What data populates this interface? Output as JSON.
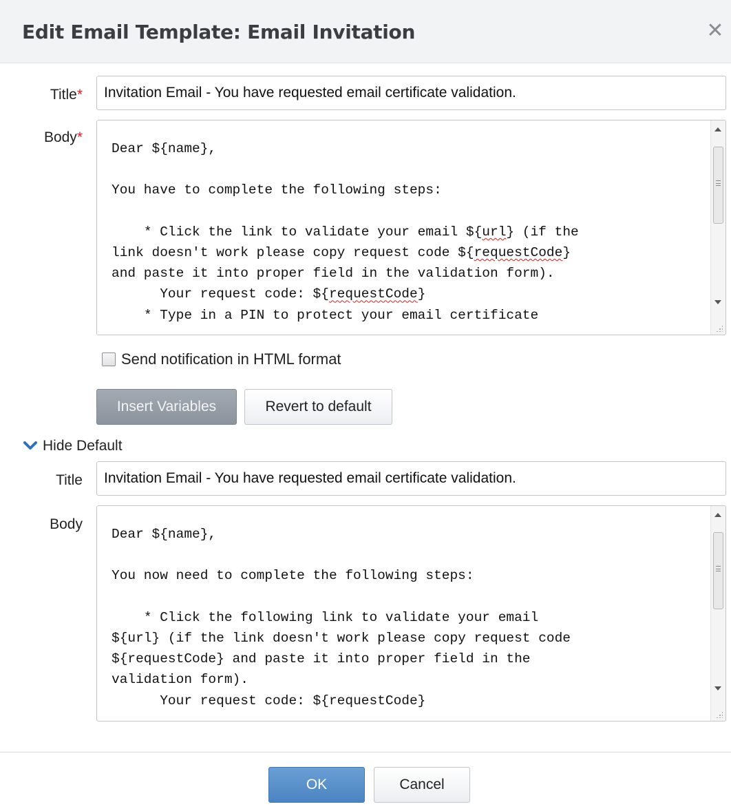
{
  "dialog": {
    "title": "Edit Email Template: Email Invitation",
    "close_glyph": "✕"
  },
  "form": {
    "title_label": "Title",
    "body_label": "Body",
    "required_mark": "*",
    "title_value": "Invitation Email - You have requested email certificate validation.",
    "body_lines": [
      "Dear ${name},",
      "",
      "You have to complete the following steps:",
      "",
      "    * Click the link to validate your email ${url} (if the",
      "link doesn't work please copy request code ${requestCode}",
      "and paste it into proper field in the validation form).",
      "      Your request code: ${requestCode}",
      "    * Type in a PIN to protect your email certificate"
    ],
    "html_checkbox_label": "Send notification in HTML format",
    "html_checkbox_checked": false,
    "insert_variables_label": "Insert Variables",
    "revert_label": "Revert to default"
  },
  "default_section": {
    "toggle_label": "Hide Default",
    "title_label": "Title",
    "body_label": "Body",
    "title_value": "Invitation Email - You have requested email certificate validation.",
    "body_lines": [
      "Dear ${name},",
      "",
      "You now need to complete the following steps:",
      "",
      "    * Click the following link to validate your email",
      "${url} (if the link doesn't work please copy request code",
      "${requestCode} and paste it into proper field in the",
      "validation form).",
      "      Your request code: ${requestCode}"
    ]
  },
  "footer": {
    "ok_label": "OK",
    "cancel_label": "Cancel"
  },
  "colors": {
    "ok_button": "#4a84c2",
    "insert_button": "#8c939c",
    "required": "#d0202a",
    "chevron": "#2e72bd"
  }
}
